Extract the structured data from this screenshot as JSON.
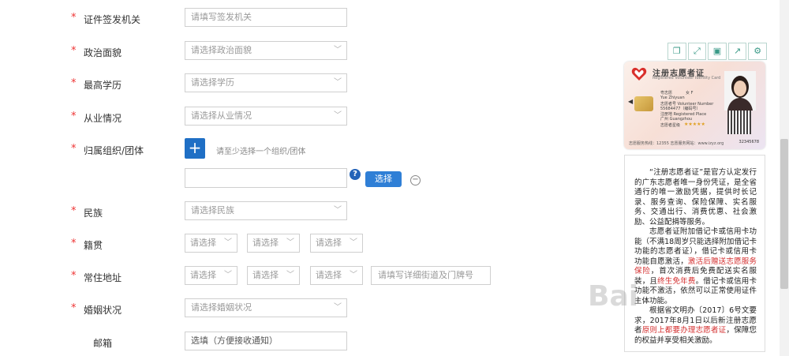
{
  "form": {
    "issuing_authority": {
      "label": "证件签发机关",
      "placeholder": "请填写签发机关"
    },
    "political_status": {
      "label": "政治面貌",
      "placeholder": "请选择政治面貌"
    },
    "education": {
      "label": "最高学历",
      "placeholder": "请选择学历"
    },
    "employment": {
      "label": "从业情况",
      "placeholder": "请选择从业情况"
    },
    "organization": {
      "label": "归属组织/团体",
      "plus": "+",
      "hint": "请至少选择一个组织/团体",
      "input_value": "",
      "help": "?",
      "select_label": "选择",
      "minus": "−"
    },
    "ethnicity": {
      "label": "民族",
      "placeholder": "请选择民族"
    },
    "native_place": {
      "label": "籍贯",
      "sel1": "请选择",
      "sel2": "请选择",
      "sel3": "请选择"
    },
    "residence": {
      "label": "常住地址",
      "sel1": "请选择",
      "sel2": "请选择",
      "sel3": "请选择",
      "detail_placeholder": "请填写详细街道及门牌号"
    },
    "marital": {
      "label": "婚姻状况",
      "placeholder": "请选择婚姻状况"
    },
    "email": {
      "label": "邮箱",
      "placeholder": "选填（方便接收通知）"
    },
    "required_mark": "*"
  },
  "toolbar": {
    "icons": [
      "copy-icon",
      "expand-icon",
      "save-icon",
      "share-icon",
      "settings-icon"
    ]
  },
  "card": {
    "title": "注册志愿者证",
    "subtitle": "Registered Volunteer Identity Card",
    "name": "粤志愿",
    "name_en": "Yue Zhiyuan",
    "gender": "女 F",
    "number": "55684477（编码号）",
    "volunteer_no_label": "志愿者号 Volunteer Number",
    "place_label": "注册地 Registered Place",
    "place": "广州 Guangzhou",
    "stars_label": "志愿者星级",
    "hotline": "志愿服务热线：12355   志愿服务网站：www.izyz.org",
    "id_number": "32345678"
  },
  "info": {
    "p1": "“注册志愿者证”是官方认定发行的广东志愿者唯一身份凭证，是全省通行的唯一激励凭据，提供时长记录、服务查询、保险保障、实名服务、交通出行、消费优惠、社会激励、公益配捐等服务。",
    "p2_a": "志愿者证附加借记卡或信用卡功能（不满18周岁只能选择附加借记卡功能的志愿者证），借记卡或信用卡功能自愿激活，",
    "p2_red1": "激活后赠送志愿服务保险",
    "p2_b": "，首次消费后免费配送实名服装，且",
    "p2_red2": "终生免年费",
    "p2_c": "。借记卡或信用卡功能不激活，依然可以正常使用证件主体功能。",
    "p3_a": "根据省文明办〔2017〕6号文要求，2017年8月1日以后新注册志愿者",
    "p3_red": "原则上都要办理志愿者证",
    "p3_b": "，保障您的权益并享受相关激励。"
  },
  "watermark": "Bai"
}
